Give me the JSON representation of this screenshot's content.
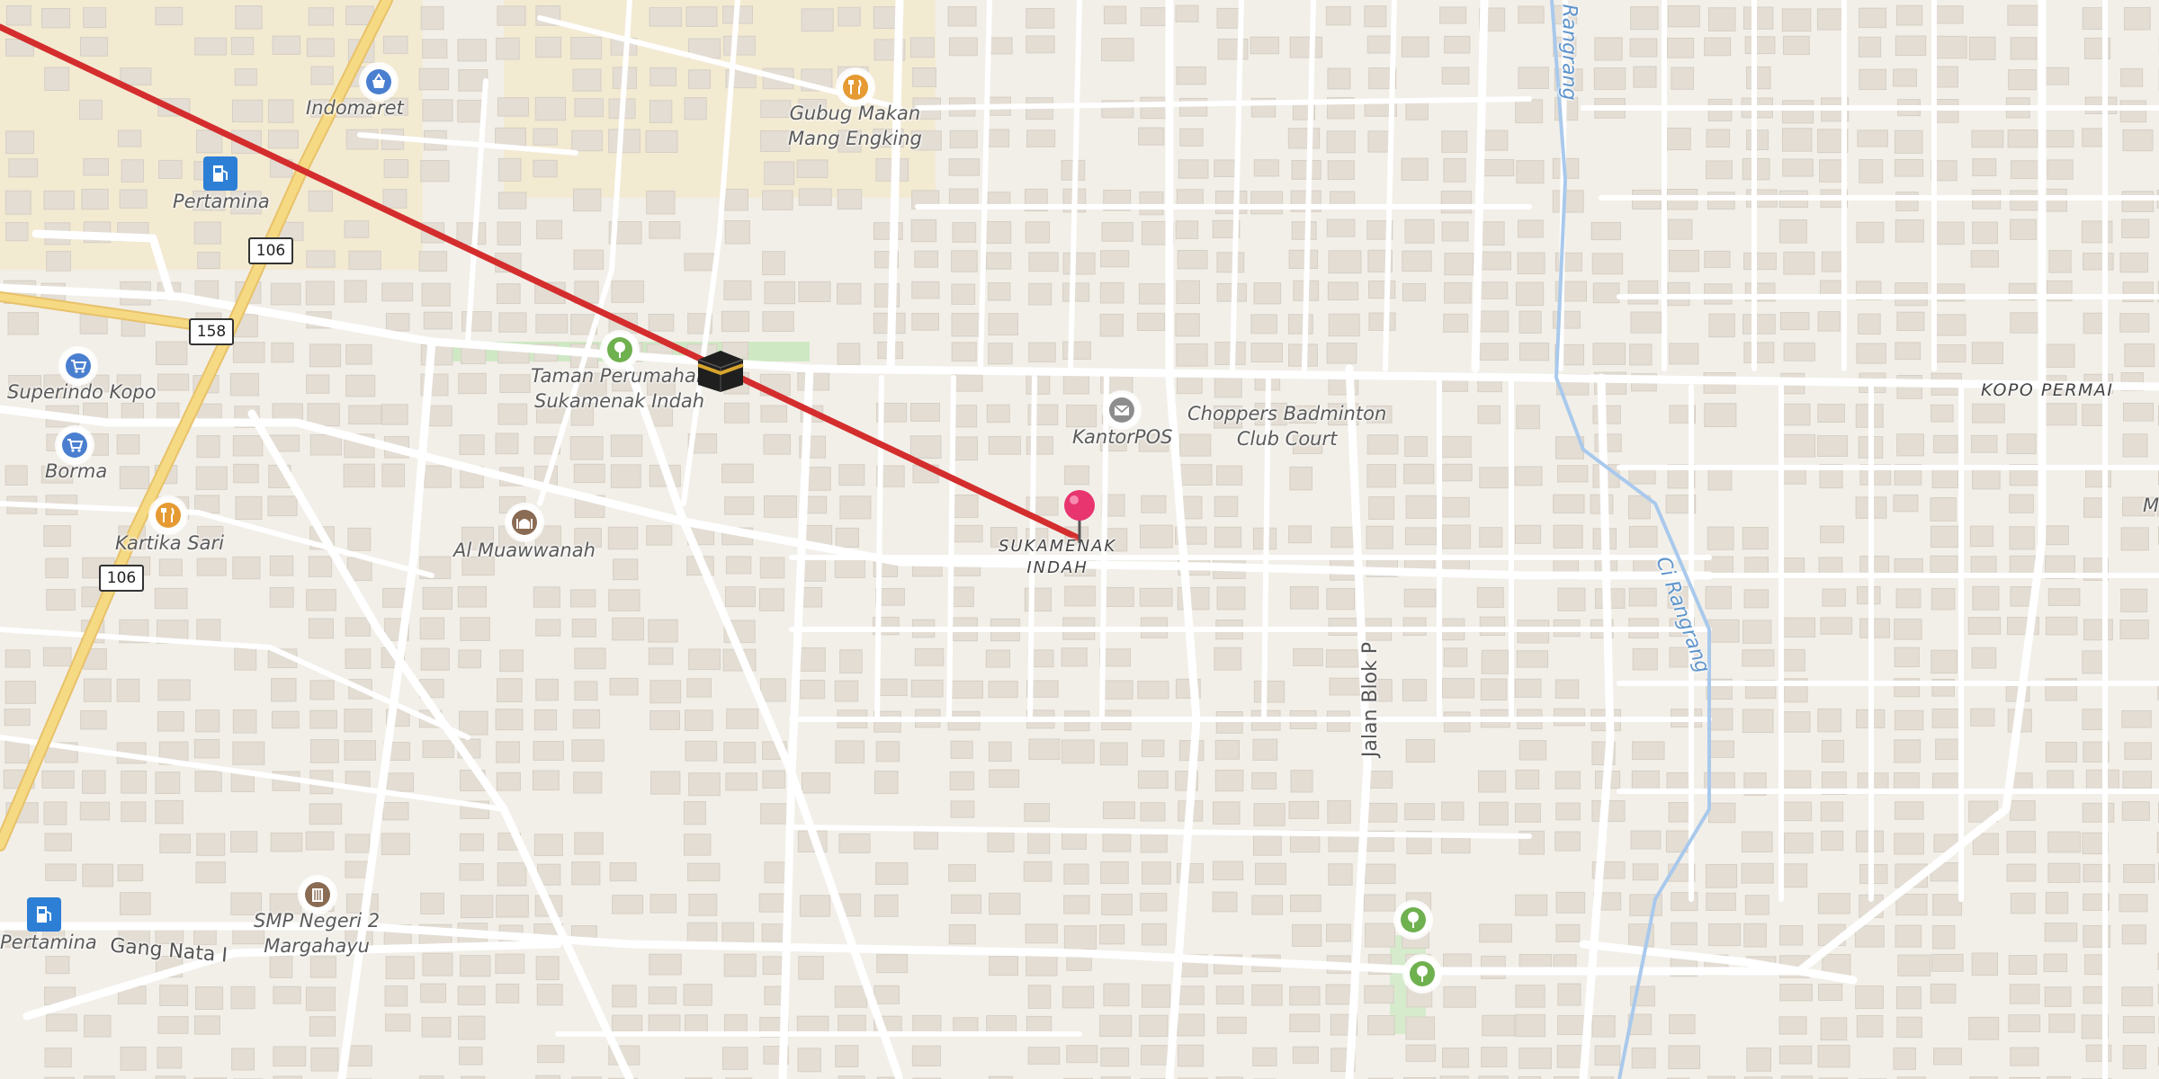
{
  "map": {
    "colors": {
      "background": "#f2efe9",
      "building": "#e3ddd4",
      "road": "#ffffff",
      "main_road": "#f6d983",
      "route": "#d42d2d",
      "river": "#a9c9ec",
      "park": "#cfe8c4",
      "marker": "#e8346f"
    },
    "labels": {
      "indomaret": "Indomaret",
      "pertamina_top": "Pertamina",
      "superindo": "Superindo Kopo",
      "borma": "Borma",
      "kartika_line1": "Kartika Sari",
      "gubug_line1": "Gubug Makan",
      "gubug_line2": "Mang Engking",
      "taman_line1": "Taman Perumahan",
      "taman_line2": "Sukamenak Indah",
      "al_muawwanah": "Al Muawwanah",
      "kantorpos": "KantorPOS",
      "choppers_line1": "Choppers Badminton",
      "choppers_line2": "Club Court",
      "sukamenak_line1": "SUKAMENAK",
      "sukamenak_line2": "INDAH",
      "kopo_permai": "KOPO PERMAI",
      "smp_line1": "SMP Negeri 2",
      "smp_line2": "Margahayu",
      "pertamina_bottom": "Pertamina",
      "gang_nata": "Gang Nata I",
      "jalan_blok_p": "Jalan Blok P",
      "ci_rangrang": "Ci Rangrang",
      "rangrang_top": "Rangrang",
      "edge_m": "M"
    },
    "road_shields": {
      "r106_top": "106",
      "r158": "158",
      "r106_mid": "106"
    },
    "icons": {
      "indomaret": "shopping-basket-icon",
      "pertamina_top": "fuel-pump-icon",
      "superindo": "shopping-cart-icon",
      "borma": "shopping-cart-icon",
      "kartika": "restaurant-icon",
      "gubug": "restaurant-icon",
      "taman": "park-tree-icon",
      "kaaba": "kaaba-icon",
      "al_muawwanah": "mosque-icon",
      "kantorpos": "post-office-icon",
      "smp": "school-icon",
      "pertamina_bottom": "fuel-pump-icon",
      "tree1": "park-tree-icon",
      "tree2": "park-tree-icon",
      "destination": "location-pin-icon"
    }
  }
}
